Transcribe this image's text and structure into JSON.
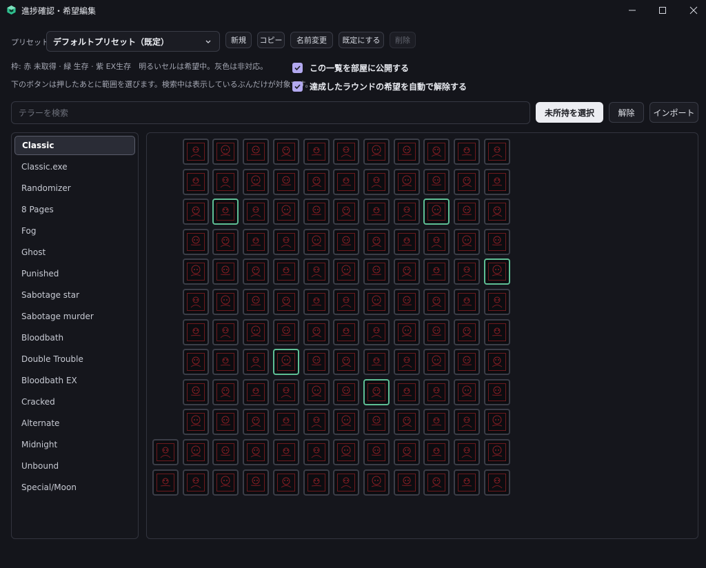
{
  "window": {
    "title": "進捗確認・希望編集"
  },
  "preset": {
    "label": "プリセット",
    "selected": "デフォルトプリセット（既定）",
    "buttons": [
      {
        "label": "新規",
        "disabled": false
      },
      {
        "label": "コピー",
        "disabled": false
      },
      {
        "label": "名前変更",
        "disabled": false
      },
      {
        "label": "既定にする",
        "disabled": false
      },
      {
        "label": "削除",
        "disabled": true
      }
    ]
  },
  "legend": {
    "line1": "枠: 赤 未取得 · 緑 生存 · 紫 EX生存　明るいセルは希望中。灰色は非対応。",
    "line2": "下のボタンは押したあとに範囲を選びます。検索中は表示しているぶんだけが対象です。"
  },
  "options": {
    "publish_label": "この一覧を部屋に公開する",
    "publish_checked": true,
    "auto_clear_label": "達成したラウンドの希望を自動で解除する",
    "auto_clear_checked": true
  },
  "search": {
    "placeholder": "テラーを検索",
    "value": ""
  },
  "actions": {
    "select_unowned": "未所持を選択",
    "clear": "解除",
    "import": "インポート"
  },
  "sidebar": {
    "items": [
      {
        "label": "Classic",
        "active": true
      },
      {
        "label": "Classic.exe"
      },
      {
        "label": "Randomizer"
      },
      {
        "label": "8 Pages"
      },
      {
        "label": "Fog"
      },
      {
        "label": "Ghost"
      },
      {
        "label": "Punished"
      },
      {
        "label": "Sabotage star"
      },
      {
        "label": "Sabotage murder"
      },
      {
        "label": "Bloodbath"
      },
      {
        "label": "Double Trouble"
      },
      {
        "label": "Bloodbath EX"
      },
      {
        "label": "Cracked"
      },
      {
        "label": "Alternate"
      },
      {
        "label": "Midnight"
      },
      {
        "label": "Unbound"
      },
      {
        "label": "Special/Moon"
      }
    ]
  },
  "grid": {
    "rows": [
      {
        "start_col": 1,
        "count": 11,
        "green": []
      },
      {
        "start_col": 1,
        "count": 11,
        "green": []
      },
      {
        "start_col": 1,
        "count": 11,
        "green": [
          1,
          8
        ]
      },
      {
        "start_col": 1,
        "count": 11,
        "green": []
      },
      {
        "start_col": 1,
        "count": 11,
        "green": [
          10
        ]
      },
      {
        "start_col": 1,
        "count": 11,
        "green": []
      },
      {
        "start_col": 1,
        "count": 11,
        "green": []
      },
      {
        "start_col": 1,
        "count": 11,
        "green": [
          3
        ]
      },
      {
        "start_col": 1,
        "count": 11,
        "green": [
          6
        ]
      },
      {
        "start_col": 1,
        "count": 11,
        "green": []
      },
      {
        "start_col": 0,
        "count": 12,
        "green": []
      },
      {
        "start_col": 0,
        "count": 12,
        "green": []
      }
    ]
  },
  "colors": {
    "accent": "#b3a9f0",
    "frame_red": "#6e1a1e",
    "frame_green": "#5fbf95",
    "frame_default": "#3b3d47"
  }
}
